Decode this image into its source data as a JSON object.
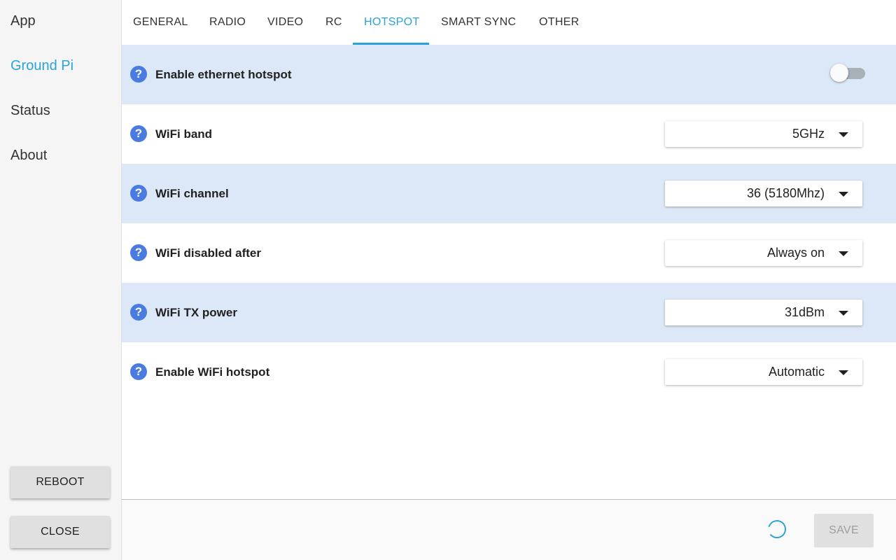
{
  "sidebar": {
    "items": [
      {
        "label": "App",
        "active": false
      },
      {
        "label": "Ground Pi",
        "active": true
      },
      {
        "label": "Status",
        "active": false
      },
      {
        "label": "About",
        "active": false
      }
    ],
    "reboot_label": "REBOOT",
    "close_label": "CLOSE"
  },
  "tabs": [
    {
      "label": "GENERAL"
    },
    {
      "label": "RADIO"
    },
    {
      "label": "VIDEO"
    },
    {
      "label": "RC"
    },
    {
      "label": "HOTSPOT",
      "active": true
    },
    {
      "label": "SMART SYNC"
    },
    {
      "label": "OTHER"
    }
  ],
  "settings": {
    "rows": [
      {
        "label": "Enable ethernet hotspot",
        "control": "toggle",
        "enabled": false
      },
      {
        "label": "WiFi band",
        "control": "select",
        "value": "5GHz"
      },
      {
        "label": "WiFi channel",
        "control": "select",
        "value": "36 (5180Mhz)"
      },
      {
        "label": "WiFi disabled after",
        "control": "select",
        "value": "Always on"
      },
      {
        "label": "WiFi TX power",
        "control": "select",
        "value": "31dBm"
      },
      {
        "label": "Enable WiFi hotspot",
        "control": "select",
        "value": "Automatic"
      }
    ],
    "help_glyph": "?"
  },
  "footer": {
    "save_label": "SAVE"
  },
  "colors": {
    "accent": "#29a3d8",
    "row_shade": "#dce8f7",
    "help_icon": "#4a7be0"
  }
}
